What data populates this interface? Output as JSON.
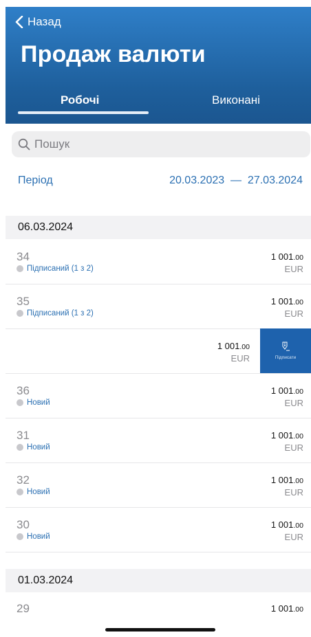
{
  "nav": {
    "back_label": "Назад",
    "title": "Продаж валюти"
  },
  "tabs": [
    {
      "label": "Робочі",
      "active": true
    },
    {
      "label": "Виконані",
      "active": false
    }
  ],
  "search": {
    "placeholder": "Пошук"
  },
  "period": {
    "label": "Період",
    "range": "20.03.2023  —  27.03.2024"
  },
  "sections": [
    {
      "date": "06.03.2024",
      "rows": [
        {
          "number": "34",
          "status": "Підписаний (1 з 2)",
          "amount_int": "1 001",
          "amount_dec": ".00",
          "currency": "EUR"
        },
        {
          "number": "35",
          "status": "Підписаний (1 з 2)",
          "amount_int": "1 001",
          "amount_dec": ".00",
          "currency": "EUR"
        },
        {
          "number": "",
          "status": "",
          "amount_int": "1 001",
          "amount_dec": ".00",
          "currency": "EUR",
          "swiped_action": "Підписати"
        },
        {
          "number": "36",
          "status": "Новий",
          "amount_int": "1 001",
          "amount_dec": ".00",
          "currency": "EUR"
        },
        {
          "number": "31",
          "status": "Новий",
          "amount_int": "1 001",
          "amount_dec": ".00",
          "currency": "EUR"
        },
        {
          "number": "32",
          "status": "Новий",
          "amount_int": "1 001",
          "amount_dec": ".00",
          "currency": "EUR"
        },
        {
          "number": "30",
          "status": "Новий",
          "amount_int": "1 001",
          "amount_dec": ".00",
          "currency": "EUR"
        }
      ]
    },
    {
      "date": "01.03.2024",
      "rows": [
        {
          "number": "29",
          "status": "",
          "amount_int": "1 001",
          "amount_dec": ".00",
          "currency": ""
        }
      ]
    }
  ],
  "colors": {
    "header_top": "#2f7fc8",
    "header_bottom": "#1b5690",
    "accent": "#2a6fb2",
    "sign_button": "#1e62ad"
  },
  "icons": {
    "back": "chevron-left-icon",
    "search": "search-icon",
    "sign": "pen-icon"
  }
}
